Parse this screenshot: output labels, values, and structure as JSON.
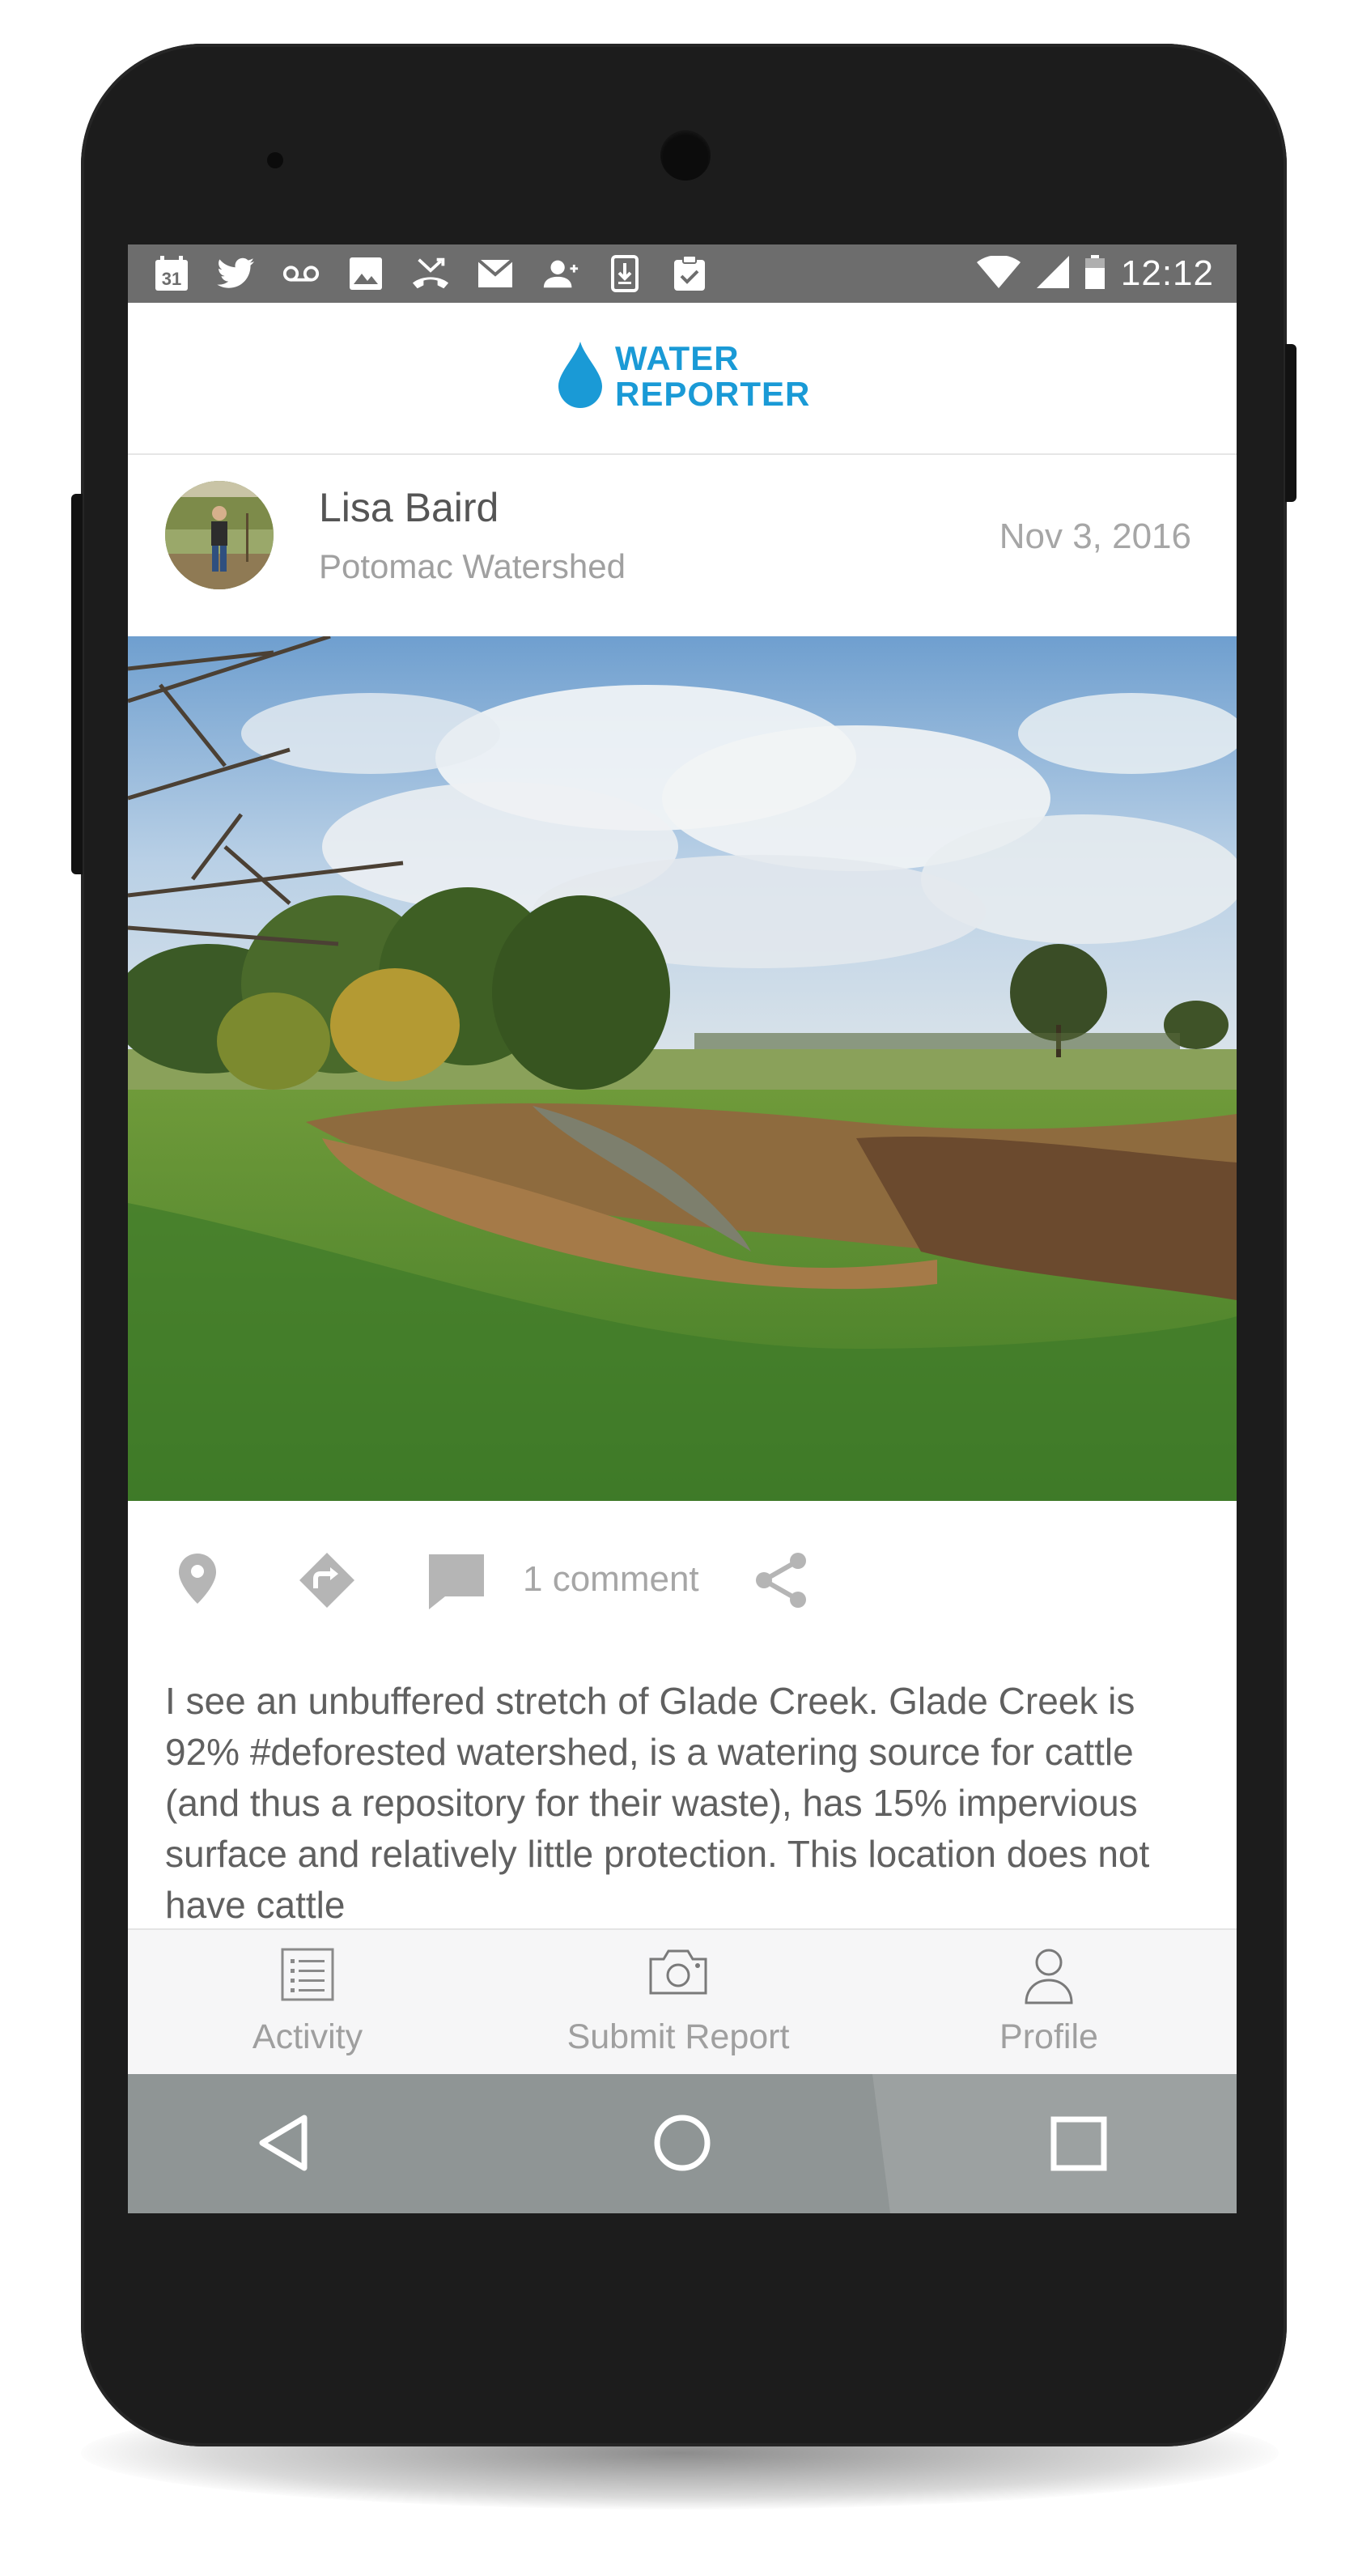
{
  "status_bar": {
    "time": "12:12",
    "calendar_day": "31",
    "left_icons": [
      "calendar-icon",
      "twitter-icon",
      "voicemail-icon",
      "image-icon",
      "missed-call-icon",
      "mail-icon",
      "add-person-icon",
      "download-icon",
      "clipboard-check-icon"
    ],
    "right_icons": [
      "wifi-icon",
      "signal-icon",
      "battery-icon"
    ]
  },
  "app": {
    "logo_line1": "WATER",
    "logo_line2": "REPORTER",
    "brand_color": "#1a9ad6"
  },
  "post": {
    "user_name": "Lisa Baird",
    "group": "Potomac Watershed",
    "date": "Nov 3, 2016",
    "comment_count": "1 comment",
    "body": "I see an unbuffered stretch of Glade Creek. Glade Creek is 92% #deforested watershed, is a watering source for cattle (and thus a repository for their waste), has 15% impervious surface and relatively little protection. This location does not have cattle"
  },
  "tabs": [
    {
      "label": "Activity",
      "icon": "list-icon"
    },
    {
      "label": "Submit Report",
      "icon": "camera-icon"
    },
    {
      "label": "Profile",
      "icon": "person-icon"
    }
  ],
  "nav": [
    "back-icon",
    "home-icon",
    "recents-icon"
  ]
}
